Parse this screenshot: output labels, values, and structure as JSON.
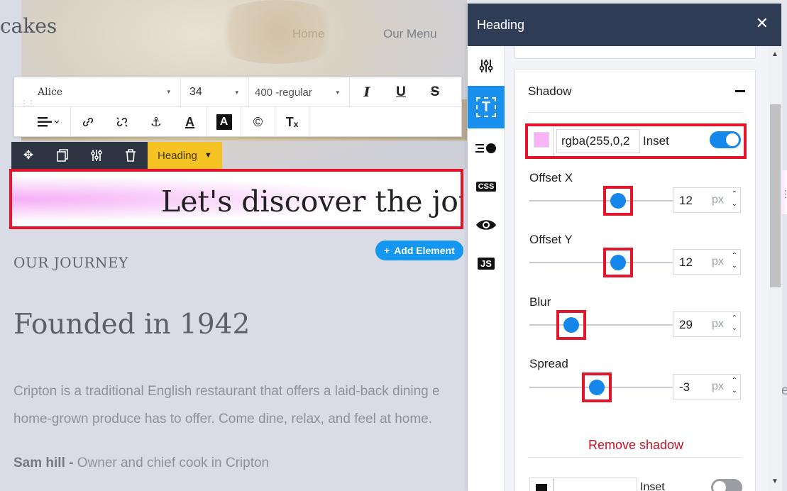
{
  "site": {
    "logo": "cakes",
    "nav": [
      "Home",
      "Our Menu"
    ],
    "heading_text": "Let's discover the jou",
    "add_element": "Add Element",
    "section_label": "OUR JOURNEY",
    "title": "Founded in 1942",
    "paragraph_lines": [
      "Cripton is a traditional English restaurant that offers a laid-back dining e",
      "home-grown produce has to offer. Come dine, relax, and feel at home."
    ],
    "signature_name": "Sam hill -",
    "signature_role": " Owner and chief cook in Cripton",
    "stray_letter": "e"
  },
  "text_toolbar": {
    "font": "Alice",
    "size": "34",
    "weight": "400 -regular",
    "italic": "I",
    "underline": "U",
    "strike": "S",
    "text_color": "A",
    "bg_color": "A",
    "copyright": "©",
    "clear_format": "Tₓ"
  },
  "element_toolbar": {
    "tag_label": "Heading"
  },
  "panel": {
    "title": "Heading",
    "section_title": "Shadow",
    "shadow_color_value": "rgba(255,0,2",
    "shadow_color_hex": "#f9b4f7",
    "inset_label": "Inset",
    "inset_on": true,
    "sliders": [
      {
        "label": "Offset X",
        "value": "12",
        "unit": "px",
        "fraction": 0.62
      },
      {
        "label": "Offset Y",
        "value": "12",
        "unit": "px",
        "fraction": 0.62
      },
      {
        "label": "Blur",
        "value": "29",
        "unit": "px",
        "fraction": 0.29
      },
      {
        "label": "Spread",
        "value": "-3",
        "unit": "px",
        "fraction": 0.47
      }
    ],
    "remove_shadow": "Remove shadow",
    "second_inset_label": "Inset",
    "rail": [
      "settings-icon",
      "text-style-icon",
      "alignment-icon",
      "CSS",
      "visibility-icon",
      "JS"
    ]
  },
  "colors": {
    "accent_blue": "#1587ea",
    "panel_header": "#2f3c55",
    "highlight_red": "#e4152a",
    "tag_yellow": "#f6c324"
  }
}
